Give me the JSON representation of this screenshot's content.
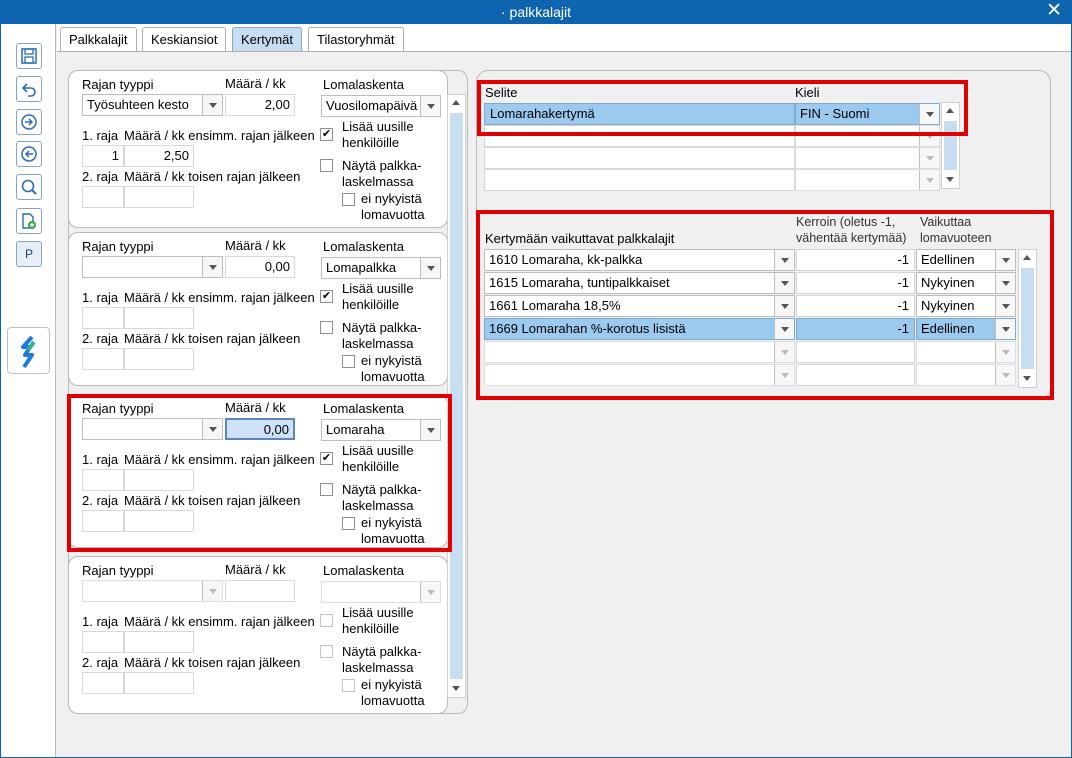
{
  "window": {
    "title": "palkkalajit",
    "close_icon": "close-icon"
  },
  "tabs": [
    "Palkkalajit",
    "Keskiansiot",
    "Kertymät",
    "Tilastoryhmät"
  ],
  "active_tab": "Kertymät",
  "toolbar": {
    "icons": [
      "save-icon",
      "undo-icon",
      "next-icon",
      "previous-icon",
      "search-icon",
      "new-document-icon"
    ],
    "p_button": "P",
    "logo": "app-logo-icon"
  },
  "labels": {
    "rajan_tyyppi": "Rajan tyyppi",
    "maara_kk": "Määrä / kk",
    "lomalaskenta": "Lomalaskenta",
    "raja1": "1. raja",
    "maara_ensimm": "Määrä / kk ensimm. rajan jälkeen",
    "raja2": "2. raja",
    "maara_toisen": "Määrä / kk toisen rajan jälkeen",
    "lisaa_1": "Lisää uusille",
    "lisaa_2": "henkilöille",
    "nayta_1": "Näytä palkka-",
    "nayta_2": "laskelmassa",
    "ei_1": "ei nykyistä",
    "ei_2": "lomavuotta"
  },
  "accrual_groups": [
    {
      "rajan_tyyppi": "Työsuhteen kesto",
      "maara": "2,00",
      "lomalaskenta": "Vuosilomapäivä",
      "raja1": "1",
      "maara_ensimm": "2,50",
      "raja2": "",
      "maara_toisen": "",
      "lisaa": true,
      "nayta": false,
      "ei_nykyista": false
    },
    {
      "rajan_tyyppi": "",
      "maara": "0,00",
      "lomalaskenta": "Lomapalkka",
      "raja1": "",
      "maara_ensimm": "",
      "raja2": "",
      "maara_toisen": "",
      "lisaa": true,
      "nayta": false,
      "ei_nykyista": false
    },
    {
      "rajan_tyyppi": "",
      "maara": "0,00",
      "lomalaskenta": "Lomaraha",
      "raja1": "",
      "maara_ensimm": "",
      "raja2": "",
      "maara_toisen": "",
      "lisaa": true,
      "nayta": false,
      "ei_nykyista": false
    },
    {
      "rajan_tyyppi": "",
      "maara": "",
      "lomalaskenta": "",
      "raja1": "",
      "maara_ensimm": "",
      "raja2": "",
      "maara_toisen": "",
      "lisaa": false,
      "nayta": false,
      "ei_nykyista": false
    }
  ],
  "selite_table": {
    "headers": {
      "selite": "Selite",
      "kieli": "Kieli"
    },
    "rows": [
      {
        "selite": "Lomarahakertymä",
        "kieli": "FIN - Suomi"
      },
      {
        "selite": "",
        "kieli": ""
      },
      {
        "selite": "",
        "kieli": ""
      },
      {
        "selite": "",
        "kieli": ""
      }
    ]
  },
  "kertyma_table": {
    "headers": {
      "palkkalajit": "Kertymään vaikuttavat palkkalajit",
      "kerroin_1": "Kerroin (oletus -1,",
      "kerroin_2": "vähentää kertymää)",
      "vaikuttaa_1": "Vaikuttaa",
      "vaikuttaa_2": "lomavuoteen"
    },
    "rows": [
      {
        "palkkalaji": "1610 Lomaraha, kk-palkka",
        "kerroin": "-1",
        "vaikuttaa": "Edellinen"
      },
      {
        "palkkalaji": "1615 Lomaraha, tuntipalkkaiset",
        "kerroin": "-1",
        "vaikuttaa": "Nykyinen"
      },
      {
        "palkkalaji": "1661 Lomaraha 18,5%",
        "kerroin": "-1",
        "vaikuttaa": "Nykyinen"
      },
      {
        "palkkalaji": "1669 Lomarahan %-korotus lisistä",
        "kerroin": "-1",
        "vaikuttaa": "Edellinen"
      },
      {
        "palkkalaji": "",
        "kerroin": "",
        "vaikuttaa": ""
      },
      {
        "palkkalaji": "",
        "kerroin": "",
        "vaikuttaa": ""
      }
    ]
  }
}
